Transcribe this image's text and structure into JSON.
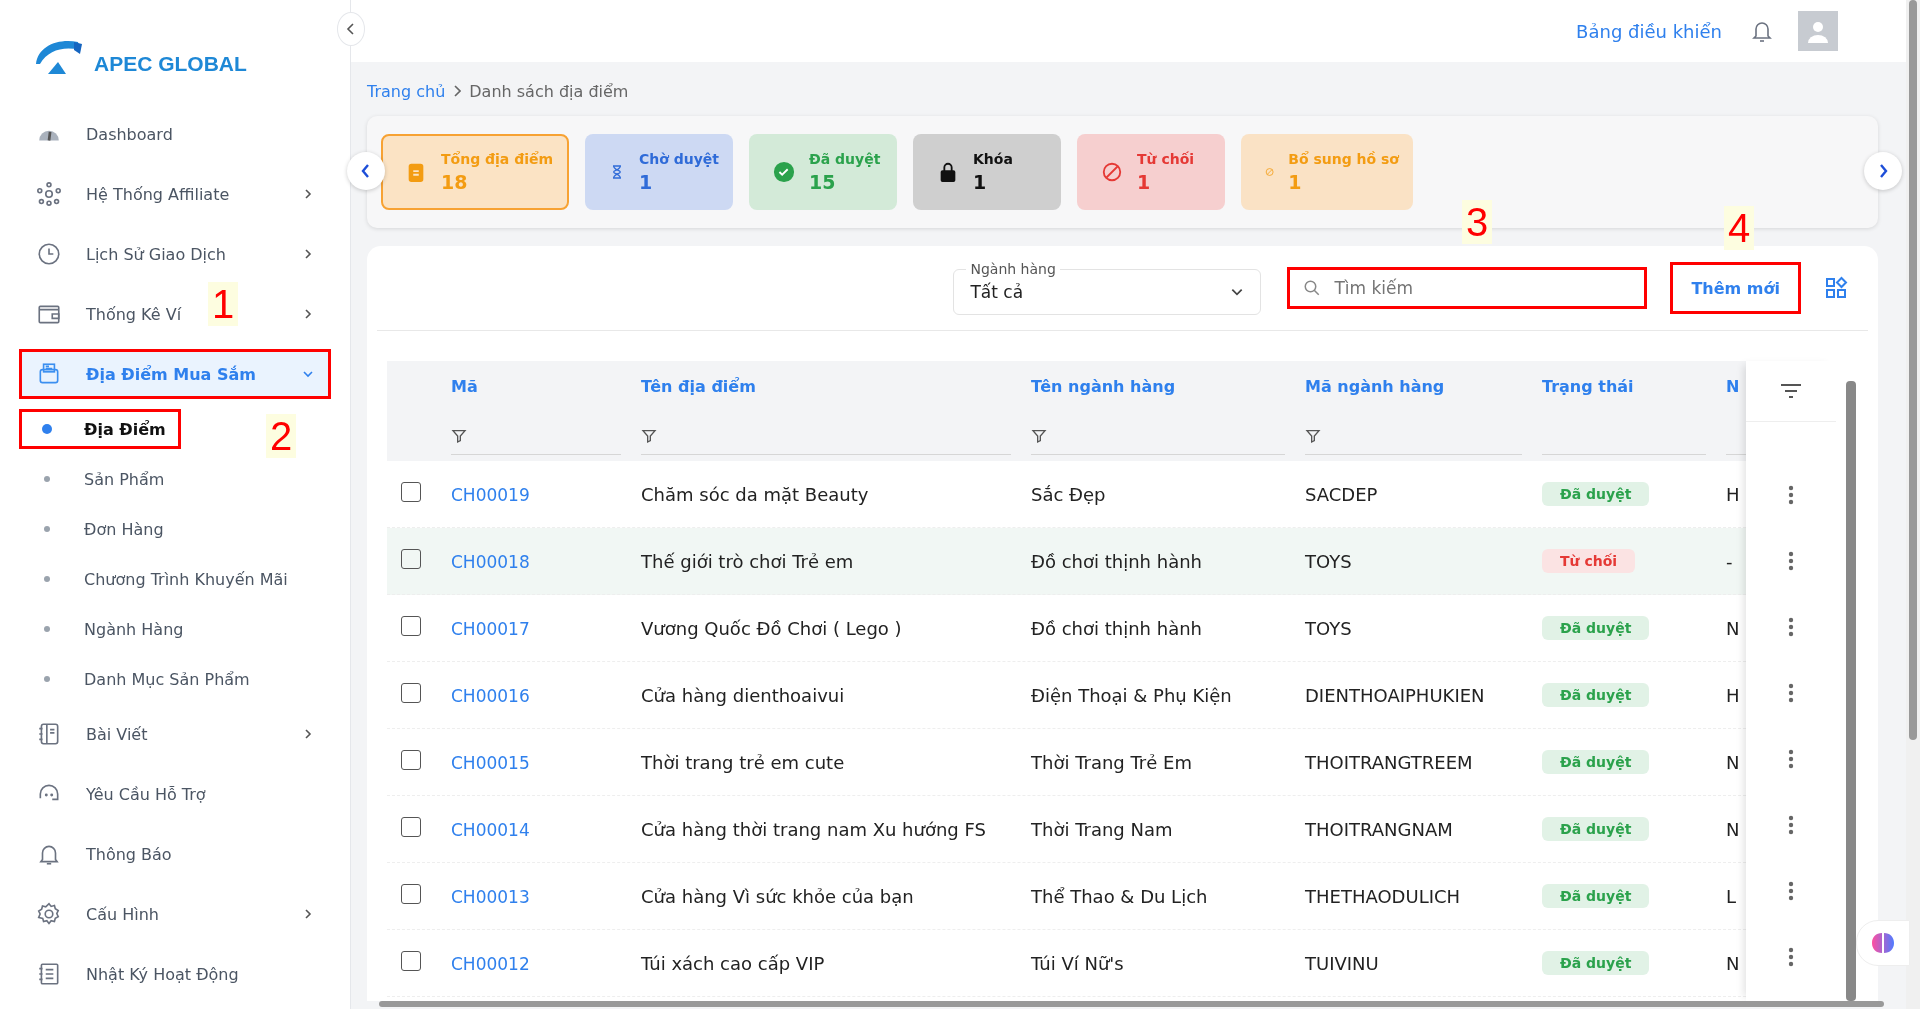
{
  "logo": {
    "text": "APEC GLOBAL"
  },
  "sidebar": {
    "items": [
      {
        "label": "Dashboard",
        "expandable": false,
        "expanded": false,
        "selected": false,
        "marked": false
      },
      {
        "label": "Hệ Thống Affiliate",
        "expandable": true,
        "expanded": false,
        "selected": false,
        "marked": false
      },
      {
        "label": "Lịch Sử Giao Dịch",
        "expandable": true,
        "expanded": false,
        "selected": false,
        "marked": false
      },
      {
        "label": "Thống Kê Ví",
        "expandable": true,
        "expanded": false,
        "selected": false,
        "marked": false
      },
      {
        "label": "Địa Điểm Mua Sắm",
        "expandable": true,
        "expanded": true,
        "selected": true,
        "marked": true,
        "children": [
          {
            "label": "Địa Điểm",
            "selected": true,
            "marked": true
          },
          {
            "label": "Sản Phẩm",
            "selected": false,
            "marked": false
          },
          {
            "label": "Đơn Hàng",
            "selected": false,
            "marked": false
          },
          {
            "label": "Chương Trình Khuyến Mãi",
            "selected": false,
            "marked": false
          },
          {
            "label": "Ngành Hàng",
            "selected": false,
            "marked": false
          },
          {
            "label": "Danh Mục Sản Phẩm",
            "selected": false,
            "marked": false
          }
        ]
      },
      {
        "label": "Bài Viết",
        "expandable": true,
        "expanded": false,
        "selected": false,
        "marked": false
      },
      {
        "label": "Yêu Cầu Hỗ Trợ",
        "expandable": false,
        "expanded": false,
        "selected": false,
        "marked": false
      },
      {
        "label": "Thông Báo",
        "expandable": false,
        "expanded": false,
        "selected": false,
        "marked": false
      },
      {
        "label": "Cấu Hình",
        "expandable": true,
        "expanded": false,
        "selected": false,
        "marked": false
      },
      {
        "label": "Nhật Ký Hoạt Động",
        "expandable": false,
        "expanded": false,
        "selected": false,
        "marked": false
      }
    ]
  },
  "topbar": {
    "link": "Bảng điều khiển"
  },
  "breadcrumb": [
    {
      "label": "Trang chủ",
      "kind": "link"
    },
    {
      "label": "Danh sách địa điểm",
      "kind": "current"
    }
  ],
  "stats": [
    {
      "kind": "total",
      "label": "Tổng địa điểm",
      "value": "18",
      "selected": true
    },
    {
      "kind": "pending",
      "label": "Chờ duyệt",
      "value": "1",
      "selected": false
    },
    {
      "kind": "approved",
      "label": "Đã duyệt",
      "value": "15",
      "selected": false
    },
    {
      "kind": "locked",
      "label": "Khóa",
      "value": "1",
      "selected": false
    },
    {
      "kind": "rejected",
      "label": "Từ chối",
      "value": "1",
      "selected": false
    },
    {
      "kind": "supplement",
      "label": "Bổ sung hồ sơ",
      "value": "1",
      "selected": false
    }
  ],
  "toolbar": {
    "category_filter": {
      "label": "Ngành hàng",
      "value": "Tất cả"
    },
    "search": {
      "placeholder": "Tìm kiếm",
      "marked": true
    },
    "add_button": {
      "label": "Thêm mới",
      "marked": true
    }
  },
  "annotations": [
    {
      "label": "1"
    },
    {
      "label": "2"
    },
    {
      "label": "3"
    },
    {
      "label": "4"
    }
  ],
  "table": {
    "columns": [
      {
        "label": "Mã",
        "filter": true
      },
      {
        "label": "Tên địa điểm",
        "filter": true
      },
      {
        "label": "Tên ngành hàng",
        "filter": true
      },
      {
        "label": "Mã ngành hàng",
        "filter": true
      },
      {
        "label": "Trạng thái",
        "filter": false
      },
      {
        "label": "N",
        "filter": false
      }
    ],
    "rows": [
      {
        "code": "CH00019",
        "name": "Chăm sóc da mặt Beauty",
        "category": "Sắc Đẹp",
        "category_code": "SACDEP",
        "status": "Đã duyệt",
        "color": "#2ba24c",
        "column_6": "H",
        "checked": false,
        "highlighted": false
      },
      {
        "code": "CH00018",
        "name": "Thế giới trò chơi Trẻ em",
        "category": "Đồ chơi thịnh hành",
        "category_code": "TOYS",
        "status": "Từ chối",
        "color": "#e53935",
        "column_6": "-",
        "checked": false,
        "highlighted": true
      },
      {
        "code": "CH00017",
        "name": "Vương Quốc Đồ Chơi ( Lego )",
        "category": "Đồ chơi thịnh hành",
        "category_code": "TOYS",
        "status": "Đã duyệt",
        "color": "#2ba24c",
        "column_6": "N",
        "checked": false,
        "highlighted": false
      },
      {
        "code": "CH00016",
        "name": "Cửa hàng dienthoaivui",
        "category": "Điện Thoại & Phụ Kiện",
        "category_code": "DIENTHOAIPHUKIEN",
        "status": "Đã duyệt",
        "color": "#2ba24c",
        "column_6": "H",
        "checked": false,
        "highlighted": false
      },
      {
        "code": "CH00015",
        "name": "Thời trang trẻ em cute",
        "category": "Thời Trang Trẻ Em",
        "category_code": "THOITRANGTREEM",
        "status": "Đã duyệt",
        "color": "#2ba24c",
        "column_6": "N",
        "checked": false,
        "highlighted": false
      },
      {
        "code": "CH00014",
        "name": "Cửa hàng thời trang nam Xu hướng FS",
        "category": "Thời Trang Nam",
        "category_code": "THOITRANGNAM",
        "status": "Đã duyệt",
        "color": "#2ba24c",
        "column_6": "N",
        "checked": false,
        "highlighted": false
      },
      {
        "code": "CH00013",
        "name": "Cửa hàng Vì sức khỏe của bạn",
        "category": "Thể Thao & Du Lịch",
        "category_code": "THETHAODULICH",
        "status": "Đã duyệt",
        "color": "#2ba24c",
        "column_6": "L",
        "checked": false,
        "highlighted": false
      },
      {
        "code": "CH00012",
        "name": "Túi xách cao cấp VIP",
        "category": "Túi Ví Nữ's",
        "category_code": "TUIVINU",
        "status": "Đã duyệt",
        "color": "#2ba24c",
        "column_6": "N",
        "checked": false,
        "highlighted": false
      }
    ]
  }
}
